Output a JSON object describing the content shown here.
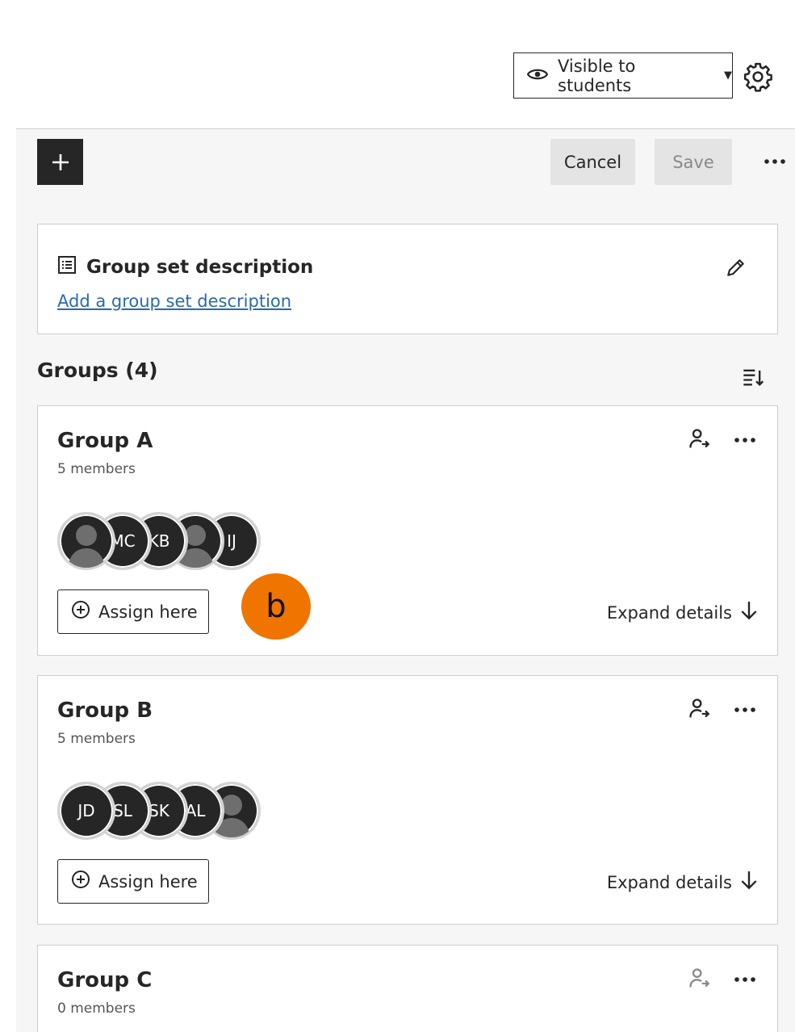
{
  "header": {
    "visibility_label": "Visible to students"
  },
  "toolbar": {
    "cancel_label": "Cancel",
    "save_label": "Save"
  },
  "description": {
    "title": "Group set description",
    "add_link": "Add a group set description"
  },
  "groups_heading": "Groups (4)",
  "groups": [
    {
      "name": "Group A",
      "members_text": "5 members",
      "avatars": [
        "",
        "MC",
        "KB",
        "",
        "IJ"
      ],
      "assign_label": "Assign here",
      "expand_label": "Expand details"
    },
    {
      "name": "Group B",
      "members_text": "5 members",
      "avatars": [
        "JD",
        "SL",
        "SK",
        "AL",
        ""
      ],
      "assign_label": "Assign here",
      "expand_label": "Expand details"
    },
    {
      "name": "Group C",
      "members_text": "0 members"
    }
  ],
  "marker_label": "b",
  "colors": {
    "marker": "#f07400",
    "link": "#2a6ab0",
    "dark": "#262626"
  }
}
